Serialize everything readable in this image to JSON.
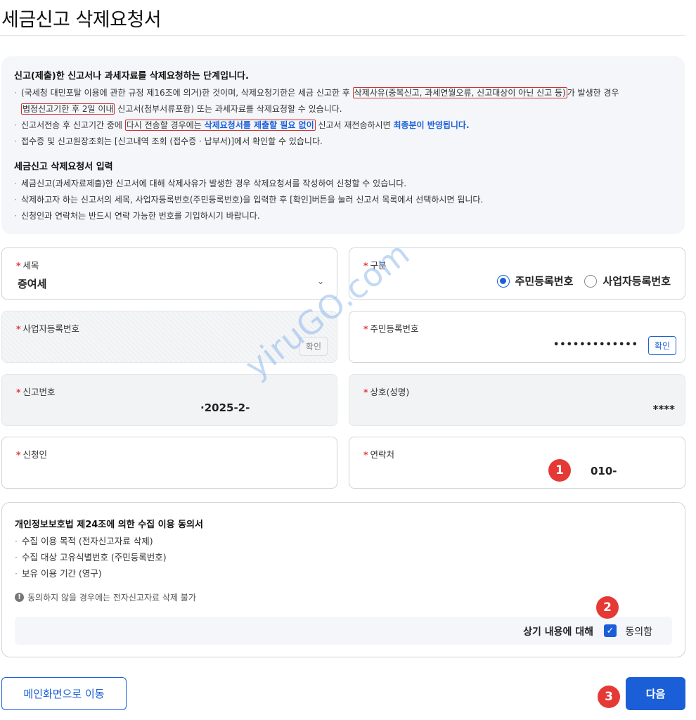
{
  "page": {
    "title": "세금신고 삭제요청서"
  },
  "info": {
    "heading1": "신고(제출)한 신고서나 과세자료를 삭제요청하는 단계입니다.",
    "line1_a": "(국세청 대민포탈 이용에 관한 규정 제16조에 의거)한 것이며, 삭제요청기한은 세금 신고한 후 ",
    "line1_hl": "삭제사유(중복신고, 과세연월오류, 신고대상이 아닌 신고 등)",
    "line1_b": "가 발생한 경우",
    "line2_hl": "법정신고기한 후 2일 이내",
    "line2_b": " 신고서(첨부서류포함) 또는 과세자료를 삭제요청할 수 있습니다.",
    "line3_a": "신고서전송 후 신고기간 중에 ",
    "line3_hl_a": "다시 전송할 경우에는 ",
    "line3_hl_blue": "삭제요청서를 제출할 필요 없이",
    "line3_b": " 신고서 재전송하시면 ",
    "line3_blue": "최종분이 반영됩니다.",
    "line4": "접수증 및 신고원장조회는 [신고내역 조회 (접수증 · 납부서)]에서 확인할 수 있습니다.",
    "heading2": "세금신고 삭제요청서 입력",
    "line5": "세금신고(과세자료제출)한 신고서에 대해 삭제사유가 발생한 경우 삭제요청서를 작성하여 신청할 수 있습니다.",
    "line6": "삭제하고자 하는 신고서의 세목, 사업자등록번호(주민등록번호)을 입력한 후 [확인]버튼을 눌러 신고서 목록에서 선택하시면 됩니다.",
    "line7": "신청인과 연락처는 반드시 연락 가능한 번호를 기입하시기 바랍니다."
  },
  "form": {
    "tax_item": {
      "label": "세목",
      "value": "증여세"
    },
    "category": {
      "label": "구분",
      "option1": "주민등록번호",
      "option2": "사업자등록번호",
      "selected": "주민등록번호"
    },
    "biz_no": {
      "label": "사업자등록번호",
      "button": "확인"
    },
    "resident_no": {
      "label": "주민등록번호",
      "value": "•••••••••••••",
      "button": "확인"
    },
    "report_no": {
      "label": "신고번호",
      "value": "·2025-2-"
    },
    "company": {
      "label": "상호(성명)",
      "value": "****"
    },
    "applicant": {
      "label": "신청인",
      "value": ""
    },
    "contact": {
      "label": "연락처",
      "value": "010-"
    }
  },
  "consent": {
    "heading": "개인정보보호법 제24조에 의한 수집 이용 동의서",
    "items": [
      "수집 이용 목적 (전자신고자료 삭제)",
      "수집 대상 고유식별번호 (주민등록번호)",
      "보유 이용 기간 (영구)"
    ],
    "notice": "동의하지 않을 경우에는 전자신고자료 삭제 불가",
    "agree_text": "상기 내용에 대해",
    "agree_label": "동의함"
  },
  "buttons": {
    "main": "메인화면으로 이동",
    "next": "다음"
  },
  "badges": {
    "b1": "1",
    "b2": "2",
    "b3": "3"
  },
  "watermark": "yiruGO.com",
  "colors": {
    "accent": "#1a5fd8",
    "required": "#e53935",
    "badge": "#e53935"
  }
}
